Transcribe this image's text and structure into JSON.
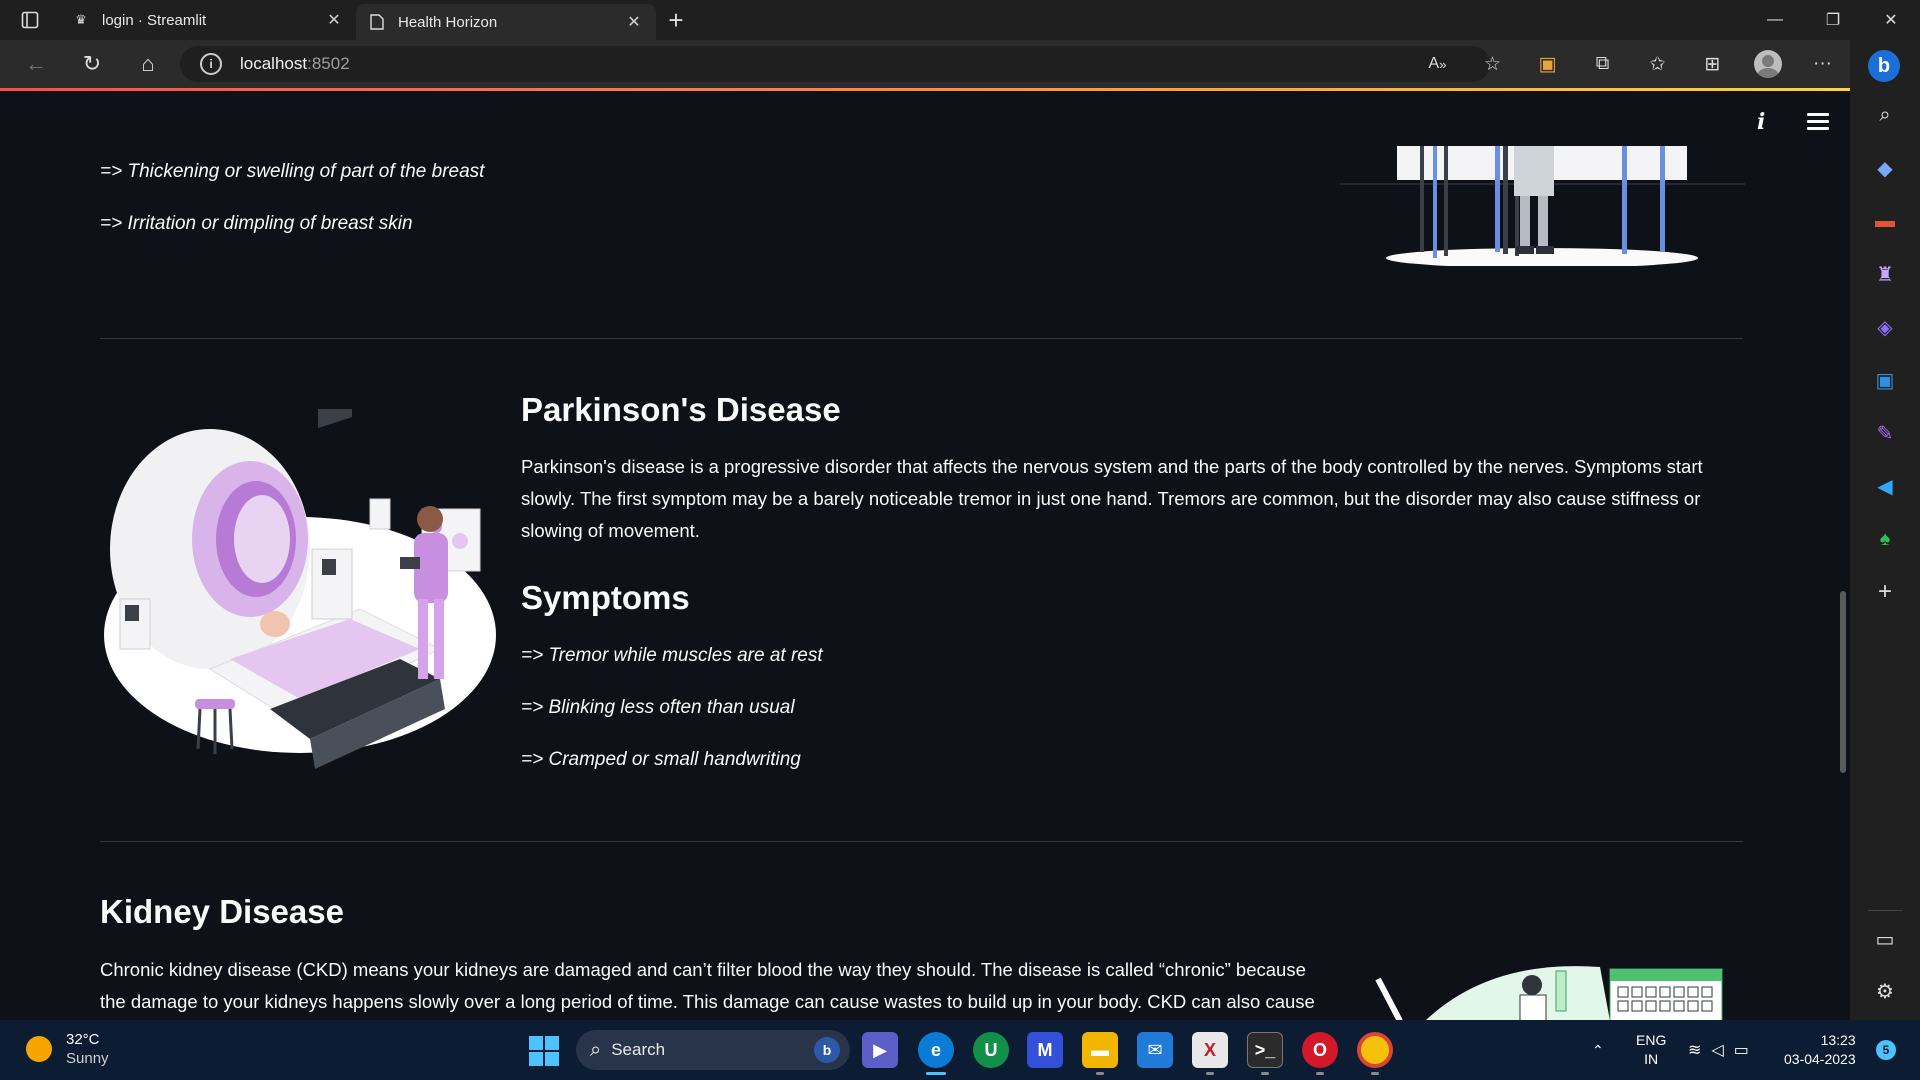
{
  "browser": {
    "tabs": [
      {
        "title": "login · Streamlit",
        "active": false
      },
      {
        "title": "Health Horizon",
        "active": true
      }
    ],
    "url_host": "localhost",
    "url_port": ":8502"
  },
  "page": {
    "breast_symptoms": [
      "=> Thickening or swelling of part of the breast",
      "=> Irritation or dimpling of breast skin"
    ],
    "parkinsons": {
      "title": "Parkinson's Disease",
      "description": "Parkinson's disease is a progressive disorder that affects the nervous system and the parts of the body controlled by the nerves. Symptoms start slowly. The first symptom may be a barely noticeable tremor in just one hand. Tremors are common, but the disorder may also cause stiffness or slowing of movement.",
      "symptoms_title": "Symptoms",
      "symptoms": [
        "=> Tremor while muscles are at rest",
        "=> Blinking less often than usual",
        "=> Cramped or small handwriting"
      ]
    },
    "kidney": {
      "title": "Kidney Disease",
      "description": "Chronic kidney disease (CKD) means your kidneys are damaged and can’t filter blood the way they should. The disease is called “chronic” because the damage to your kidneys happens slowly over a long period of time. This damage can cause wastes to build up in your body. CKD can also cause"
    }
  },
  "taskbar": {
    "weather_temp": "32°C",
    "weather_cond": "Sunny",
    "search_label": "Search",
    "lang_top": "ENG",
    "lang_bottom": "IN",
    "time": "13:23",
    "date": "03-04-2023",
    "notification_count": "5"
  },
  "colors": {
    "page_bg": "#0e1117",
    "accent": "#ff4b4b",
    "illustration_purple": "#c88ee0"
  }
}
